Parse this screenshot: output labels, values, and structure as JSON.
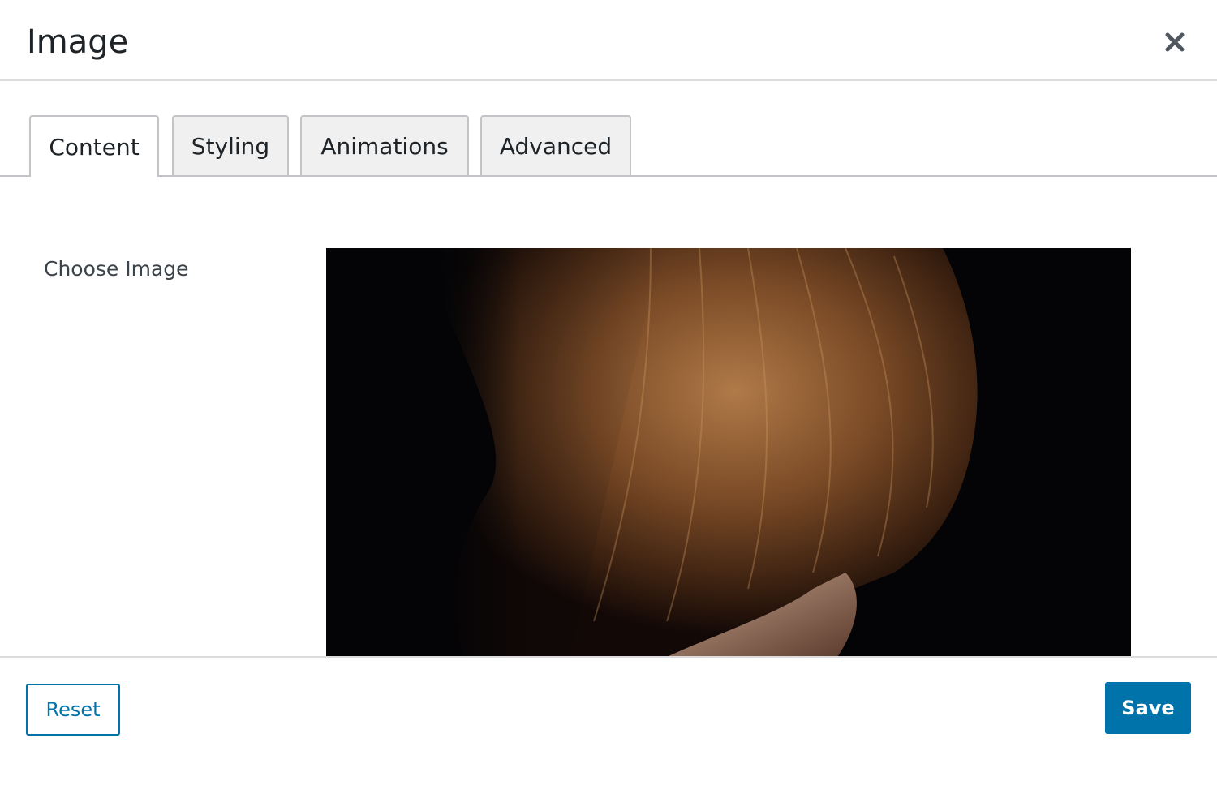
{
  "modal": {
    "title": "Image",
    "close_icon": "close-icon"
  },
  "tabs": [
    {
      "label": "Content",
      "active": true
    },
    {
      "label": "Styling",
      "active": false
    },
    {
      "label": "Animations",
      "active": false
    },
    {
      "label": "Advanced",
      "active": false
    }
  ],
  "content": {
    "choose_image_label": "Choose Image"
  },
  "footer": {
    "reset_label": "Reset",
    "save_label": "Save"
  },
  "colors": {
    "accent": "#0073aa",
    "text": "#1d2327",
    "border": "#c3c4c7",
    "tab_bg": "#f0f0f1",
    "image_bg": "#040406",
    "hair": "#8a5530"
  }
}
